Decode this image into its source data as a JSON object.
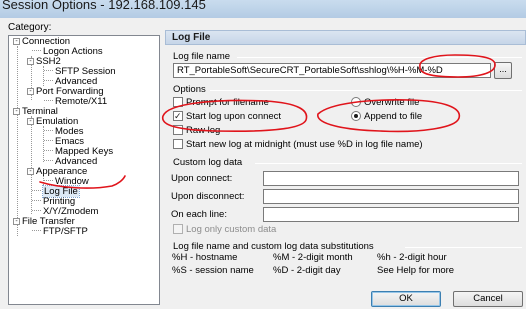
{
  "window": {
    "title": "Session Options - 192.168.109.145"
  },
  "category_label": "Category:",
  "tree": {
    "connection": "Connection",
    "logon_actions": "Logon Actions",
    "ssh2": "SSH2",
    "sftp_session": "SFTP Session",
    "advanced_ssh2": "Advanced",
    "port_forwarding": "Port Forwarding",
    "remote_x11": "Remote/X11",
    "terminal": "Terminal",
    "emulation": "Emulation",
    "modes": "Modes",
    "emacs": "Emacs",
    "mapped_keys": "Mapped Keys",
    "advanced_emulation": "Advanced",
    "appearance": "Appearance",
    "window": "Window",
    "log_file": "Log File",
    "printing": "Printing",
    "xyzmodem": "X/Y/Zmodem",
    "file_transfer": "File Transfer",
    "ftp_sftp": "FTP/SFTP",
    "collapse_glyph": "-"
  },
  "panel": {
    "header": "Log File",
    "log_file_name_label": "Log file name",
    "log_file_name_value": "RT_PortableSoft\\SecureCRT_PortableSoft\\sshlog\\%H-%M-%D",
    "browse_label": "...",
    "options_label": "Options",
    "prompt_for_filename": "Prompt for filename",
    "start_log_upon_connect": "Start log upon connect",
    "raw_log": "Raw log",
    "start_new_log_midnight": "Start new log at midnight (must use %D in log file name)",
    "overwrite_file": "Overwrite file",
    "append_to_file": "Append to file",
    "custom_log_data_label": "Custom log data",
    "upon_connect_label": "Upon connect:",
    "upon_connect_value": "",
    "upon_disconnect_label": "Upon disconnect:",
    "upon_disconnect_value": "",
    "on_each_line_label": "On each line:",
    "on_each_line_value": "",
    "log_only_custom_data": "Log only custom data",
    "substitutions_label": "Log file name and custom log data substitutions",
    "subst": {
      "h_hostname": "%H - hostname",
      "m_month": "%M - 2-digit month",
      "h_hour": "%h - 2-digit hour",
      "s_session": "%S - session name",
      "d_day": "%D - 2-digit day",
      "help": "See Help for more"
    },
    "ok_label": "OK",
    "cancel_label": "Cancel"
  },
  "state": {
    "prompt_for_filename": false,
    "start_log_upon_connect": true,
    "raw_log": false,
    "start_new_log_midnight": false,
    "log_only_custom_data": false,
    "write_mode": "append"
  },
  "colors": {
    "annotation": "#e0141b",
    "selection": "#dde9f5",
    "default_button_border": "#3c7fb1"
  }
}
